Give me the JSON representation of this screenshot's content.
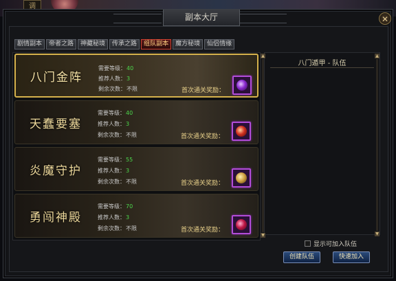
{
  "window": {
    "title": "副本大厅",
    "close_glyph": "✕",
    "badge": "调"
  },
  "tabs": [
    {
      "label": "剧情副本",
      "active": false
    },
    {
      "label": "帝者之路",
      "active": false
    },
    {
      "label": "神藏秘境",
      "active": false
    },
    {
      "label": "传承之路",
      "active": false
    },
    {
      "label": "组队副本",
      "active": true
    },
    {
      "label": "魔方秘境",
      "active": false
    },
    {
      "label": "仙侣情缘",
      "active": false
    }
  ],
  "stat_labels": {
    "level": "需要等级：",
    "players": "推荐人数：",
    "remaining": "剩余次数："
  },
  "reward_label": "首次通关奖励：",
  "dungeons": [
    {
      "name": "八门金阵",
      "level": "40",
      "players": "3",
      "remaining": "不限",
      "selected": true,
      "reward_icon": "purple-vortex-orb"
    },
    {
      "name": "天蠢要塞",
      "level": "40",
      "players": "3",
      "remaining": "不限",
      "selected": false,
      "reward_icon": "red-gem-orb"
    },
    {
      "name": "炎魔守护",
      "level": "55",
      "players": "3",
      "remaining": "不限",
      "selected": false,
      "reward_icon": "gold-pouch"
    },
    {
      "name": "勇闯神殿",
      "level": "70",
      "players": "3",
      "remaining": "不限",
      "selected": false,
      "reward_icon": "crimson-wing-orb"
    }
  ],
  "team_panel": {
    "title": "八门遁甲 - 队伍",
    "show_joinable_label": "显示可加入队伍",
    "create_button": "创建队伍",
    "quick_join_button": "快速加入"
  },
  "colors": {
    "accent_gold": "#d6b24c",
    "active_tab_border": "#d04030",
    "value_green": "#4cd84c",
    "reward_border": "#b24cd8"
  }
}
